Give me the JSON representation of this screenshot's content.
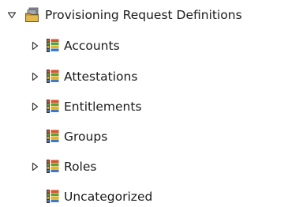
{
  "tree": {
    "root": {
      "label": "Provisioning Request Definitions",
      "icon": "folder-stack-icon",
      "expanded": true
    },
    "children": [
      {
        "label": "Accounts",
        "icon": "category-list-icon",
        "has_children": true
      },
      {
        "label": "Attestations",
        "icon": "category-list-icon",
        "has_children": true
      },
      {
        "label": "Entitlements",
        "icon": "category-list-icon",
        "has_children": true
      },
      {
        "label": "Groups",
        "icon": "category-list-icon",
        "has_children": false
      },
      {
        "label": "Roles",
        "icon": "category-list-icon",
        "has_children": true
      },
      {
        "label": "Uncategorized",
        "icon": "category-list-icon",
        "has_children": false
      }
    ]
  },
  "colors": {
    "text": "#1a1a1a",
    "toggle": "#3a3a3a",
    "icon_red": "#d9532b",
    "icon_green": "#5aa23a",
    "icon_yellow": "#e5b328",
    "icon_blue": "#3d79c4"
  }
}
